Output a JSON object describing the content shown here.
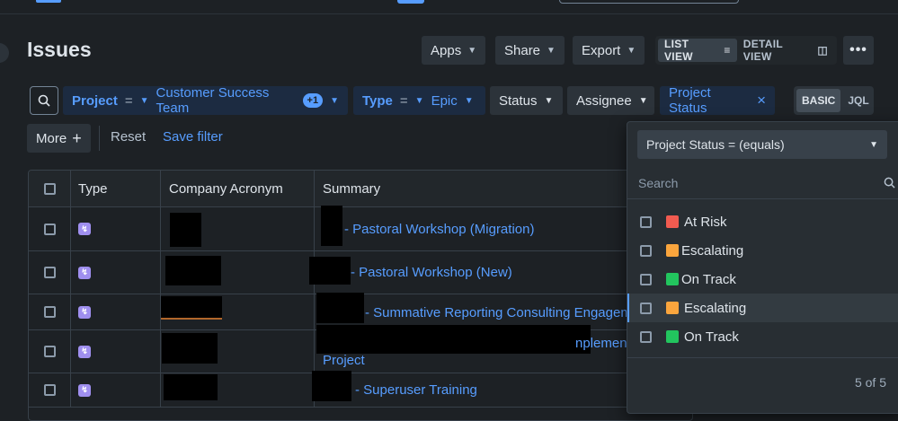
{
  "page": {
    "title": "Issues"
  },
  "header_buttons": {
    "apps": "Apps",
    "share": "Share",
    "export": "Export",
    "list_view": "LIST VIEW",
    "detail_view": "DETAIL VIEW",
    "more": "•••"
  },
  "filters": {
    "project_label": "Project",
    "project_op": "=",
    "project_value": "Customer Success Team",
    "project_extra": "+1",
    "type_label": "Type",
    "type_op": "=",
    "type_value": "Epic",
    "status_label": "Status",
    "assignee_label": "Assignee",
    "project_status_label": "Project Status",
    "basic": "BASIC",
    "jql": "JQL",
    "more": "More",
    "reset": "Reset",
    "save": "Save filter"
  },
  "table": {
    "headers": [
      "Type",
      "Company Acronym",
      "Summary"
    ],
    "rows": [
      {
        "summary": "- Pastoral Workshop (Migration)"
      },
      {
        "summary": "- Pastoral Workshop (New)"
      },
      {
        "summary": "- Summative Reporting Consulting Engagement"
      },
      {
        "summary": "nplemen",
        "summary_line2": "Project"
      },
      {
        "summary": "- Superuser Training"
      }
    ]
  },
  "dropdown": {
    "selector": "Project Status = (equals)",
    "search_placeholder": "Search",
    "options": [
      {
        "label": "At Risk",
        "color": "#f15b50"
      },
      {
        "label": "Escalating",
        "color": "#faa53d"
      },
      {
        "label": "On Track",
        "color": "#22c55e"
      },
      {
        "label": "Escalating",
        "color": "#faa53d"
      },
      {
        "label": "On Track",
        "color": "#22c55e"
      }
    ],
    "count": "5 of 5"
  },
  "icons": {
    "search": "search-icon",
    "chevron": "chevron-down-icon",
    "close": "close-icon",
    "plus": "plus-icon",
    "epic": "epic-lightning-icon"
  }
}
